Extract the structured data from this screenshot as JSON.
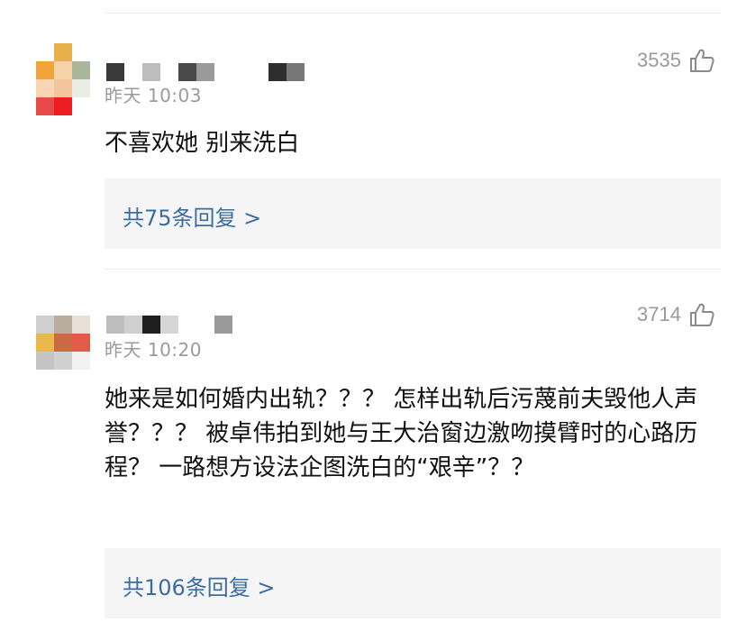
{
  "comments": [
    {
      "time": "昨天 10:03",
      "likes": "3535",
      "text": "不喜欢她 别来洗白",
      "replies": "共75条回复 >",
      "avatar_colors": [
        "#e8b04a",
        "#f6d2a8",
        "#f4c49c",
        "#a9b69a",
        "#f7d5b5",
        "#f09a8d",
        "#e84a4a",
        "#ee1c23"
      ],
      "name_colors": [
        "#3a3a3a",
        "#bdbdbd",
        "#4a4a4a",
        "#9a9a9a",
        "#2e2e2e",
        "#777777"
      ]
    },
    {
      "time": "昨天 10:20",
      "likes": "3714",
      "text": "她来是如何婚内出轨？？？ 怎样出轨后污蔑前夫毁他人声誉？？？ 被卓伟拍到她与王大治窗边激吻摸臂时的心路历程？ 一路想方设法企图洗白的“艰辛”？？",
      "replies": "共106条回复 >",
      "avatar_colors": [
        "#cfcfcf",
        "#b8ad9e",
        "#e6e0d7",
        "#e8b94a",
        "#c96a45",
        "#e35a4a",
        "#c4c4c4",
        "#d0d0d0"
      ],
      "name_colors": [
        "#bdbdbd",
        "#cfcfcf",
        "#1e1e1e",
        "#d6d6d6",
        "#9a9a9a"
      ]
    }
  ],
  "icons": {
    "like": "thumbs-up-icon"
  }
}
